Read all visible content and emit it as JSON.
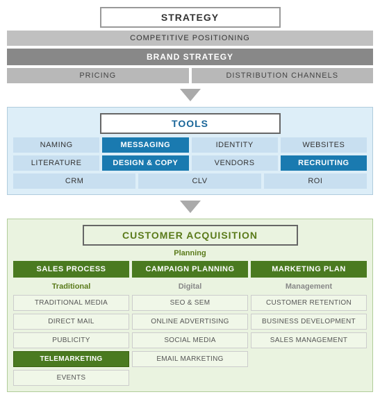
{
  "strategy": {
    "title": "STRATEGY",
    "competitive_positioning": "COMPETITIVE POSITIONING",
    "brand_strategy": "BRAND STRATEGY",
    "pricing": "PRICING",
    "distribution_channels": "DISTRIBUTION CHANNELS"
  },
  "tools": {
    "title": "TOOLS",
    "rows": [
      [
        "NAMING",
        "MESSAGING",
        "IDENTITY",
        "WEBSITES"
      ],
      [
        "LITERATURE",
        "DESIGN & COPY",
        "VENDORS",
        "RECRUITING"
      ],
      [
        "CRM",
        "CLV",
        "ROI"
      ]
    ],
    "highlighted": [
      "MESSAGING",
      "DESIGN & COPY",
      "RECRUITING"
    ]
  },
  "customer_acquisition": {
    "title": "CUSTOMER ACQUISITION",
    "planning_label": "Planning",
    "top_row": [
      "SALES PROCESS",
      "CAMPAIGN PLANNING",
      "MARKETING PLAN"
    ],
    "traditional_label": "Traditional",
    "digital_label": "Digital",
    "management_label": "Management",
    "traditional_items": [
      "TRADITIONAL MEDIA",
      "DIRECT MAIL",
      "PUBLICITY",
      "TELEMARKETING",
      "EVENTS"
    ],
    "digital_items": [
      "SEO & SEM",
      "ONLINE ADVERTISING",
      "SOCIAL MEDIA",
      "EMAIL MARKETING"
    ],
    "management_items": [
      "CUSTOMER RETENTION",
      "BUSINESS DEVELOPMENT",
      "SALES MANAGEMENT"
    ],
    "highlighted_traditional": "TELEMARKETING"
  }
}
